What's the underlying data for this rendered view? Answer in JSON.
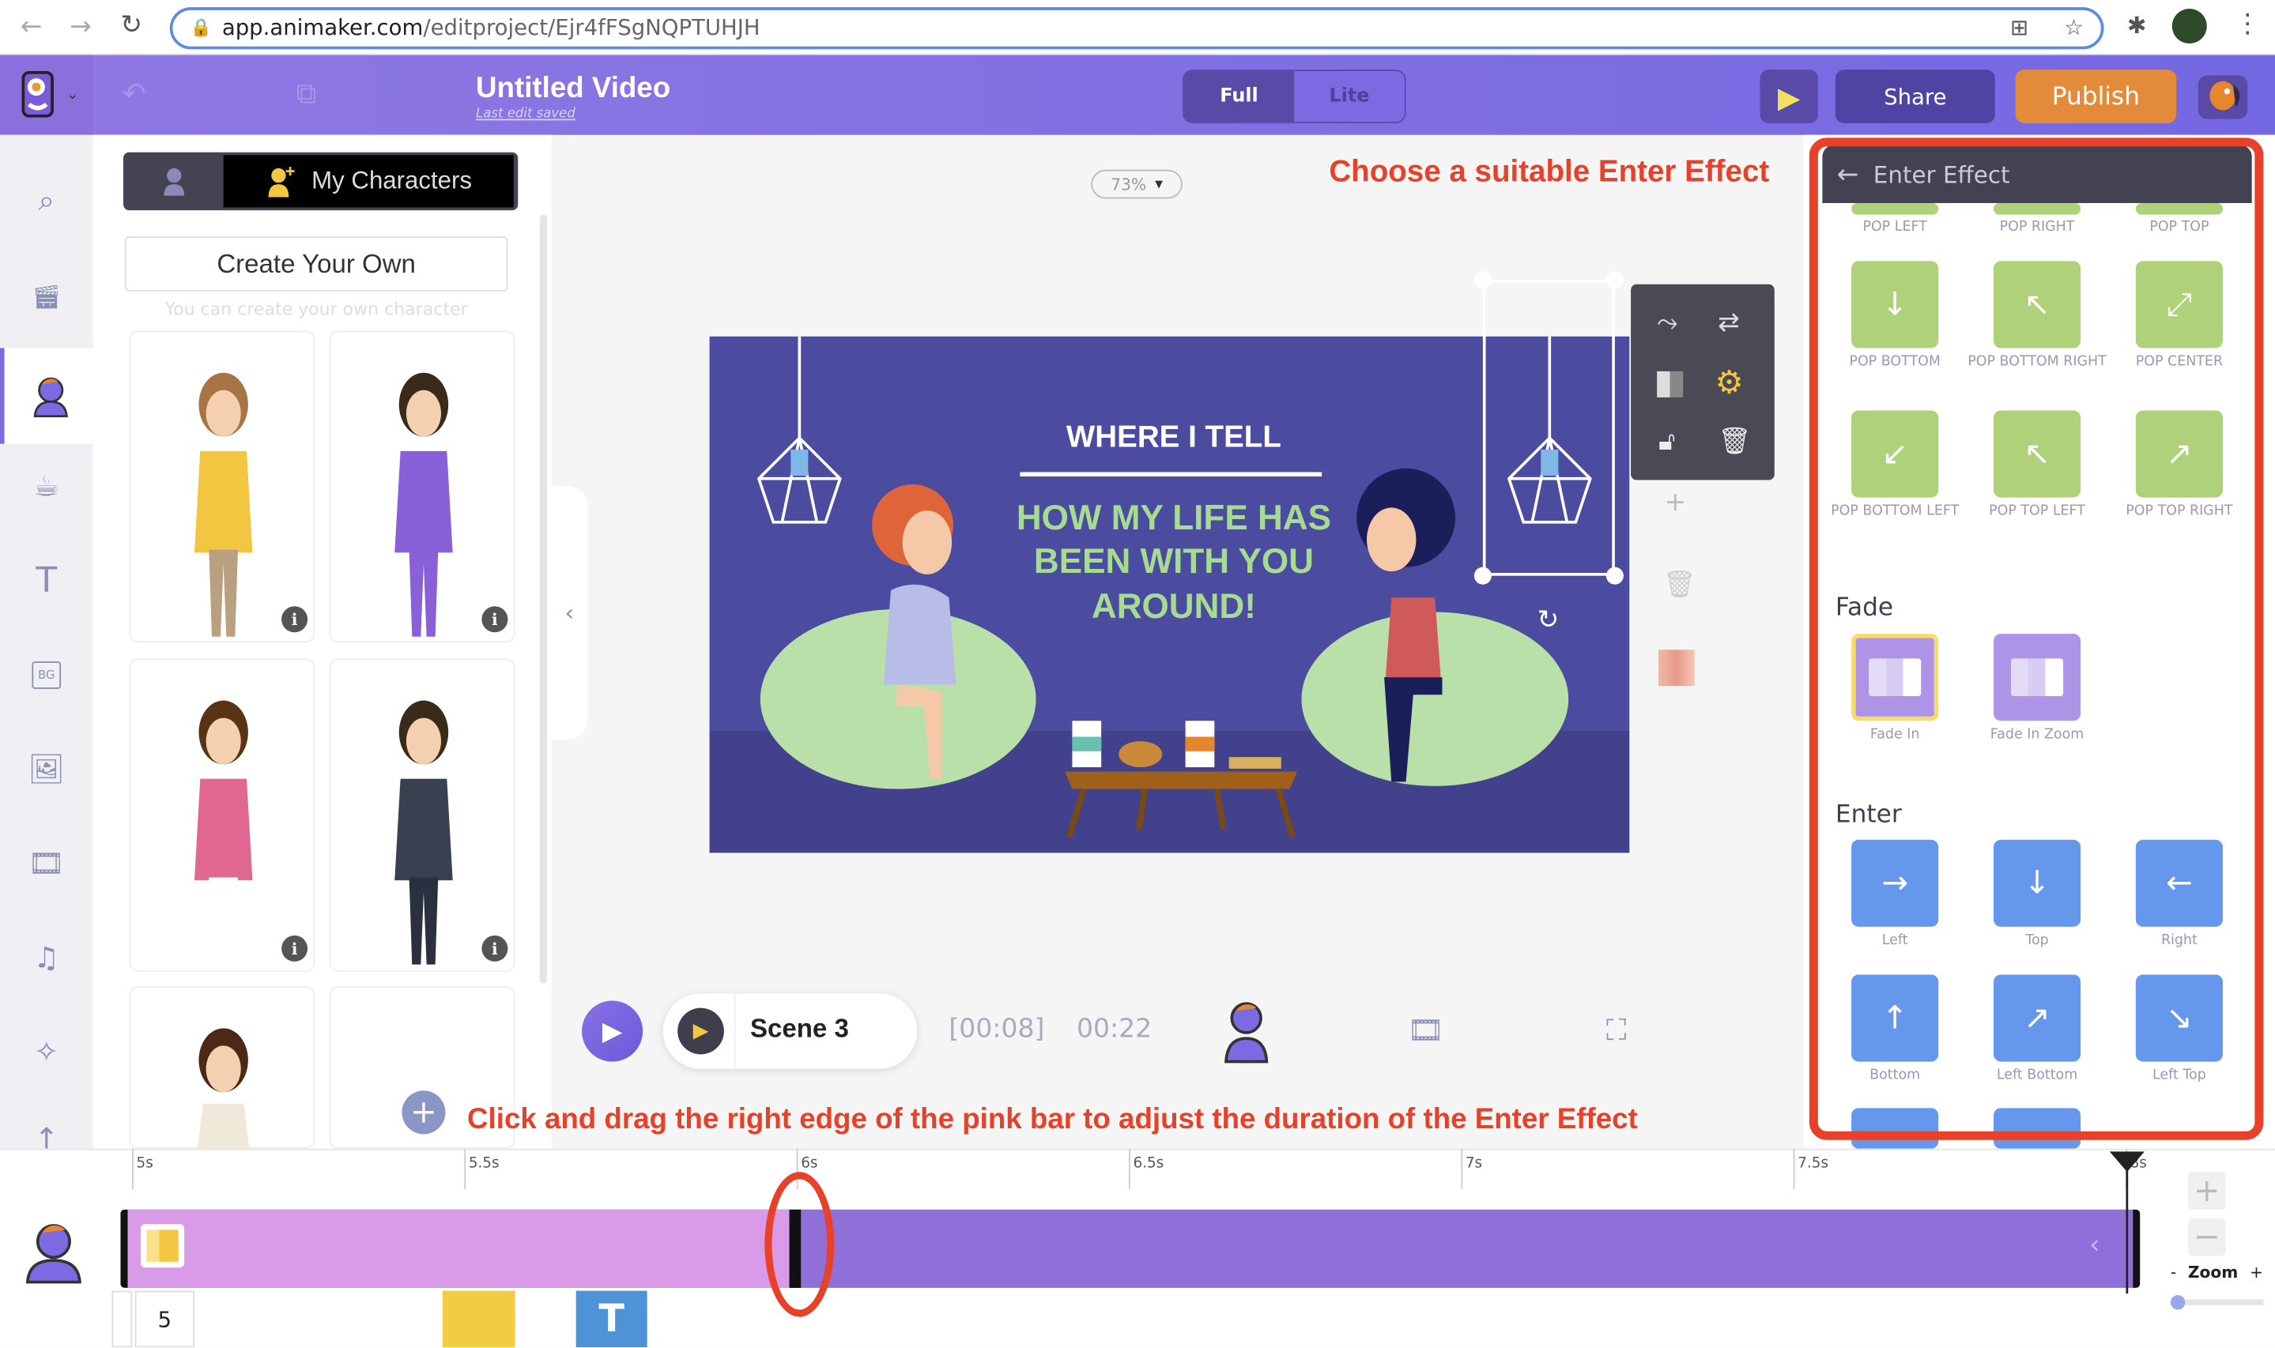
{
  "browser": {
    "url_host": "app.animaker.com",
    "url_path": "/editproject/Ejr4fFSgNQPTUHJH"
  },
  "header": {
    "title": "Untitled Video",
    "subtitle": "Last edit saved",
    "mode_full": "Full",
    "mode_lite": "Lite",
    "share": "Share",
    "publish": "Publish"
  },
  "characters": {
    "tab_label": "My Characters",
    "create_label": "Create Your Own",
    "create_hint": "You can create your own character",
    "info_glyph": "i"
  },
  "canvas": {
    "zoom": "73%",
    "scene_heading": "WHERE I TELL",
    "scene_lines": [
      "HOW MY LIFE HAS",
      "BEEN WITH YOU",
      "AROUND!"
    ]
  },
  "annotations": {
    "top": "Choose a suitable Enter Effect",
    "bottom": "Click and drag the right edge of the pink bar to adjust the duration of the Enter Effect"
  },
  "player": {
    "scene_name": "Scene 3",
    "elapsed": "[00:08]",
    "total": "00:22"
  },
  "effects": {
    "title": "Enter Effect",
    "pop_top_row": [
      "POP LEFT",
      "POP RIGHT",
      "POP TOP"
    ],
    "pop_rows": [
      [
        "POP BOTTOM",
        "POP BOTTOM RIGHT",
        "POP CENTER"
      ],
      [
        "POP BOTTOM LEFT",
        "POP TOP LEFT",
        "POP TOP RIGHT"
      ]
    ],
    "pop_glyphs": [
      [
        "↓",
        "↖",
        "⤢"
      ],
      [
        "↙",
        "↖",
        "↗"
      ]
    ],
    "fade_heading": "Fade",
    "fade": [
      "Fade In",
      "Fade In Zoom"
    ],
    "selected": "Fade In",
    "enter_heading": "Enter",
    "enter_rows": [
      [
        "Left",
        "Top",
        "Right"
      ],
      [
        "Bottom",
        "Left Bottom",
        "Left Top"
      ]
    ],
    "enter_glyphs": [
      [
        "→",
        "↓",
        "←"
      ],
      [
        "↑",
        "↗",
        "↘"
      ]
    ]
  },
  "timeline": {
    "ticks": [
      "5s",
      "5.5s",
      "6s",
      "6.5s",
      "7s",
      "7.5s",
      "8s"
    ],
    "scene_number": "5",
    "text_item": "T",
    "zoom_label": "Zoom",
    "zoom_minus": "-",
    "zoom_plus": "+",
    "effect_end_seconds": 6.0,
    "item_end_seconds": 8.0
  },
  "colors": {
    "accent": "#7b6ae2",
    "publish": "#e38b3a",
    "annotation": "#e8412a",
    "effect_bar": "#d99be8",
    "item_bar": "#8f70d8",
    "pop_tile": "#aed179",
    "enter_tile": "#6598ec",
    "fade_tile": "#ad94e6"
  }
}
